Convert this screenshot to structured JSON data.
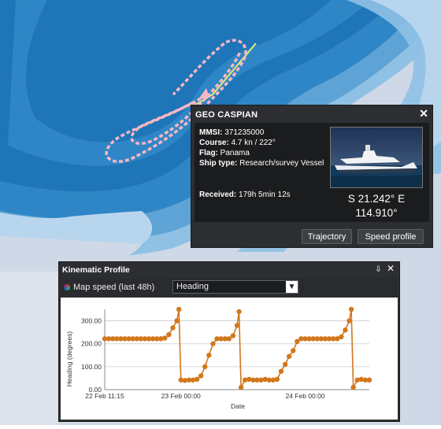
{
  "map": {
    "water_colors": [
      "#1e75b8",
      "#2f86c6",
      "#5ea3d6",
      "#8fc1e4",
      "#b7d6ee",
      "#dcdfe6"
    ],
    "land_color": "#ced8e6",
    "track_color": "#f6b6c4"
  },
  "ship": {
    "name": "GEO CASPIAN",
    "close_icon": "close-icon",
    "mmsi_label": "MMSI:",
    "mmsi": "371235000",
    "course_label": "Course:",
    "course": "4.7 kn / 222°",
    "flag_label": "Flag:",
    "flag": "Panama",
    "type_label": "Ship type:",
    "type": "Research/survey Vessel",
    "received_label": "Received:",
    "received": "179h 5min 12s",
    "coords_line1": "S 21.242° E",
    "coords_line2": "114.910°",
    "trajectory_button": "Trajectory",
    "speed_profile_button": "Speed profile"
  },
  "kinematic": {
    "title": "Kinematic Profile",
    "pin_icon": "pin-icon",
    "close_icon": "close-icon",
    "series_label": "Map speed (last 48h)",
    "select_value": "Heading"
  },
  "chart_data": {
    "type": "scatter",
    "ylabel": "Heading (degrees)",
    "xlabel": "Date",
    "ylim": [
      0,
      350
    ],
    "yticks": [
      "300.00",
      "200.00",
      "100.00",
      "0.00"
    ],
    "xticks": [
      "22 Feb 11:15",
      "23 Feb 00:00",
      "24 Feb 00:00"
    ],
    "series_color": "#d2781c",
    "points": [
      [
        0,
        222
      ],
      [
        1,
        222
      ],
      [
        2,
        222
      ],
      [
        3,
        222
      ],
      [
        4,
        222
      ],
      [
        5,
        222
      ],
      [
        6,
        222
      ],
      [
        7,
        222
      ],
      [
        8,
        222
      ],
      [
        9,
        222
      ],
      [
        10,
        222
      ],
      [
        11,
        222
      ],
      [
        12,
        222
      ],
      [
        13,
        222
      ],
      [
        14,
        222
      ],
      [
        15,
        225
      ],
      [
        16,
        240
      ],
      [
        17,
        270
      ],
      [
        18,
        300
      ],
      [
        18.5,
        350
      ],
      [
        19,
        42
      ],
      [
        20,
        40
      ],
      [
        21,
        42
      ],
      [
        22,
        42
      ],
      [
        23,
        45
      ],
      [
        24,
        60
      ],
      [
        25,
        100
      ],
      [
        26,
        150
      ],
      [
        27,
        200
      ],
      [
        28,
        222
      ],
      [
        29,
        222
      ],
      [
        30,
        222
      ],
      [
        31,
        222
      ],
      [
        32,
        235
      ],
      [
        33,
        280
      ],
      [
        33.5,
        340
      ],
      [
        34,
        10
      ],
      [
        35,
        42
      ],
      [
        36,
        45
      ],
      [
        37,
        42
      ],
      [
        38,
        42
      ],
      [
        39,
        42
      ],
      [
        40,
        45
      ],
      [
        41,
        42
      ],
      [
        42,
        42
      ],
      [
        43,
        45
      ],
      [
        44,
        80
      ],
      [
        45,
        110
      ],
      [
        46,
        145
      ],
      [
        47,
        170
      ],
      [
        48,
        210
      ],
      [
        49,
        222
      ],
      [
        50,
        222
      ],
      [
        51,
        222
      ],
      [
        52,
        222
      ],
      [
        53,
        222
      ],
      [
        54,
        222
      ],
      [
        55,
        222
      ],
      [
        56,
        222
      ],
      [
        57,
        222
      ],
      [
        58,
        222
      ],
      [
        59,
        230
      ],
      [
        60,
        260
      ],
      [
        61,
        300
      ],
      [
        61.5,
        350
      ],
      [
        62,
        10
      ],
      [
        63,
        42
      ],
      [
        64,
        45
      ],
      [
        65,
        42
      ],
      [
        66,
        42
      ]
    ]
  }
}
